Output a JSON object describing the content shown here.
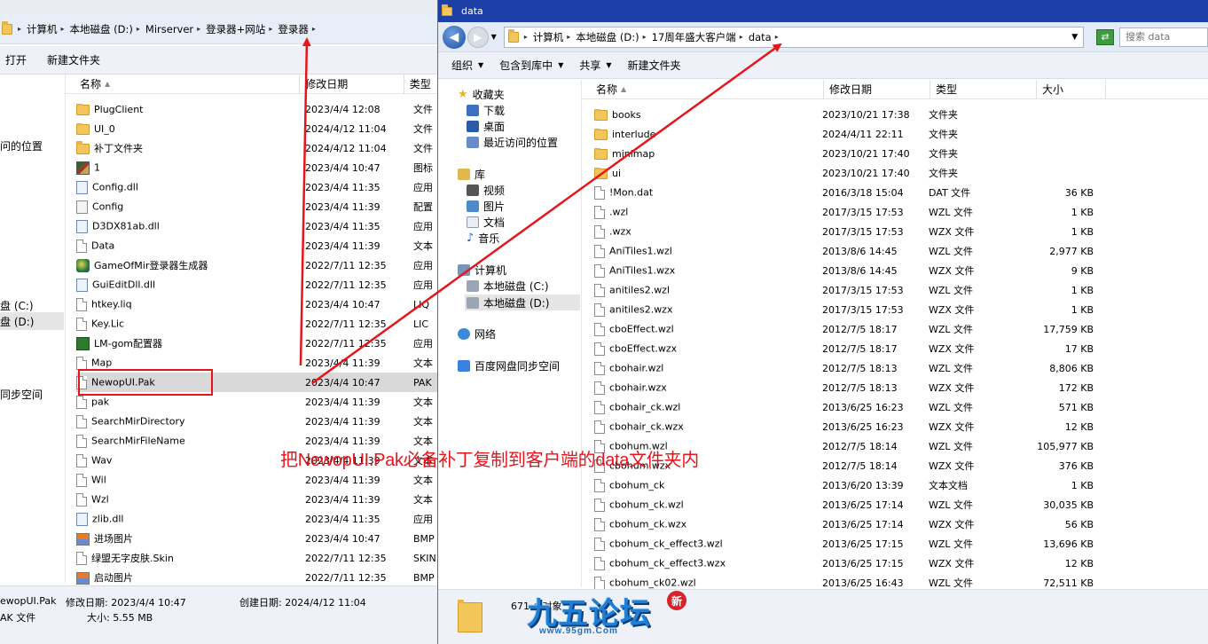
{
  "left_window": {
    "breadcrumbs": [
      "计算机",
      "本地磁盘 (D:)",
      "Mirserver",
      "登录器+网站",
      "登录器"
    ],
    "toolbar": {
      "open": "打开",
      "new_folder": "新建文件夹"
    },
    "nav": {
      "recent": "问的位置",
      "drive_c": "盘 (C:)",
      "drive_d": "盘 (D:)",
      "baidu": "同步空间"
    },
    "columns": {
      "name": "名称",
      "date": "修改日期",
      "type": "类型"
    },
    "files": [
      {
        "name": "PlugClient",
        "date": "2023/4/4 12:08",
        "type": "文件",
        "icon": "folder-icon"
      },
      {
        "name": "UI_0",
        "date": "2024/4/12 11:04",
        "type": "文件",
        "icon": "folder-icon"
      },
      {
        "name": "补丁文件夹",
        "date": "2024/4/12 11:04",
        "type": "文件",
        "icon": "folder-icon"
      },
      {
        "name": "1",
        "date": "2023/4/4 10:47",
        "type": "图标",
        "icon": "image-icon"
      },
      {
        "name": "Config.dll",
        "date": "2023/4/4 11:35",
        "type": "应用",
        "icon": "dll-icon"
      },
      {
        "name": "Config",
        "date": "2023/4/4 11:39",
        "type": "配置",
        "icon": "config-icon"
      },
      {
        "name": "D3DX81ab.dll",
        "date": "2023/4/4 11:35",
        "type": "应用",
        "icon": "dll-icon"
      },
      {
        "name": "Data",
        "date": "2023/4/4 11:39",
        "type": "文本",
        "icon": "file-icon"
      },
      {
        "name": "GameOfMir登录器生成器",
        "date": "2022/7/11 12:35",
        "type": "应用",
        "icon": "app-icon"
      },
      {
        "name": "GuiEditDll.dll",
        "date": "2022/7/11 12:35",
        "type": "应用",
        "icon": "dll-icon"
      },
      {
        "name": "htkey.liq",
        "date": "2023/4/4 10:47",
        "type": "LIQ",
        "icon": "file-icon"
      },
      {
        "name": "Key.Lic",
        "date": "2022/7/11 12:35",
        "type": "LIC",
        "icon": "file-icon"
      },
      {
        "name": "LM-gom配置器",
        "date": "2022/7/11 12:35",
        "type": "应用",
        "icon": "app2-icon"
      },
      {
        "name": "Map",
        "date": "2023/4/4 11:39",
        "type": "文本",
        "icon": "file-icon"
      },
      {
        "name": "NewopUI.Pak",
        "date": "2023/4/4 10:47",
        "type": "PAK",
        "icon": "file-icon",
        "selected": true
      },
      {
        "name": "pak",
        "date": "2023/4/4 11:39",
        "type": "文本",
        "icon": "file-icon"
      },
      {
        "name": "SearchMirDirectory",
        "date": "2023/4/4 11:39",
        "type": "文本",
        "icon": "file-icon"
      },
      {
        "name": "SearchMirFileName",
        "date": "2023/4/4 11:39",
        "type": "文本",
        "icon": "file-icon"
      },
      {
        "name": "Wav",
        "date": "2023/4/4 11:39",
        "type": "文本",
        "icon": "file-icon"
      },
      {
        "name": "Wil",
        "date": "2023/4/4 11:39",
        "type": "文本",
        "icon": "file-icon"
      },
      {
        "name": "Wzl",
        "date": "2023/4/4 11:39",
        "type": "文本",
        "icon": "file-icon"
      },
      {
        "name": "zlib.dll",
        "date": "2023/4/4 11:35",
        "type": "应用",
        "icon": "dll-icon"
      },
      {
        "name": "进场图片",
        "date": "2023/4/4 10:47",
        "type": "BMP",
        "icon": "bmp-icon"
      },
      {
        "name": "绿盟无字皮肤.Skin",
        "date": "2022/7/11 12:35",
        "type": "SKIN",
        "icon": "file-icon"
      },
      {
        "name": "启动图片",
        "date": "2022/7/11 12:35",
        "type": "BMP",
        "icon": "bmp-icon"
      }
    ],
    "status": {
      "name": "ewopUI.Pak",
      "modified": "修改日期: 2023/4/4 10:47",
      "created": "创建日期: 2024/4/12 11:04",
      "kind": "AK 文件",
      "size": "大小: 5.55 MB"
    }
  },
  "right_window": {
    "title": "data",
    "breadcrumbs": [
      "计算机",
      "本地磁盘 (D:)",
      "17周年盛大客户端",
      "data"
    ],
    "search_placeholder": "搜索 data",
    "toolbar": {
      "organize": "组织",
      "include_library": "包含到库中",
      "share": "共享",
      "new_folder": "新建文件夹"
    },
    "nav": {
      "favorites": "收藏夹",
      "downloads": "下载",
      "desktop": "桌面",
      "recent": "最近访问的位置",
      "library": "库",
      "videos": "视频",
      "pictures": "图片",
      "documents": "文档",
      "music": "音乐",
      "computer": "计算机",
      "drive_c": "本地磁盘 (C:)",
      "drive_d": "本地磁盘 (D:)",
      "network": "网络",
      "baidu": "百度网盘同步空间"
    },
    "columns": {
      "name": "名称",
      "date": "修改日期",
      "type": "类型",
      "size": "大小"
    },
    "files": [
      {
        "name": "books",
        "date": "2023/10/21 17:38",
        "type": "文件夹",
        "size": "",
        "icon": "folder-icon"
      },
      {
        "name": "interlude",
        "date": "2024/4/11 22:11",
        "type": "文件夹",
        "size": "",
        "icon": "folder-icon"
      },
      {
        "name": "minimap",
        "date": "2023/10/21 17:40",
        "type": "文件夹",
        "size": "",
        "icon": "folder-icon"
      },
      {
        "name": "ui",
        "date": "2023/10/21 17:40",
        "type": "文件夹",
        "size": "",
        "icon": "folder-icon"
      },
      {
        "name": "!Mon.dat",
        "date": "2016/3/18 15:04",
        "type": "DAT 文件",
        "size": "36 KB",
        "icon": "file-icon"
      },
      {
        "name": ".wzl",
        "date": "2017/3/15 17:53",
        "type": "WZL 文件",
        "size": "1 KB",
        "icon": "file-icon"
      },
      {
        "name": ".wzx",
        "date": "2017/3/15 17:53",
        "type": "WZX 文件",
        "size": "1 KB",
        "icon": "file-icon"
      },
      {
        "name": "AniTiles1.wzl",
        "date": "2013/8/6 14:45",
        "type": "WZL 文件",
        "size": "2,977 KB",
        "icon": "file-icon"
      },
      {
        "name": "AniTiles1.wzx",
        "date": "2013/8/6 14:45",
        "type": "WZX 文件",
        "size": "9 KB",
        "icon": "file-icon"
      },
      {
        "name": "anitiles2.wzl",
        "date": "2017/3/15 17:53",
        "type": "WZL 文件",
        "size": "1 KB",
        "icon": "file-icon"
      },
      {
        "name": "anitiles2.wzx",
        "date": "2017/3/15 17:53",
        "type": "WZX 文件",
        "size": "1 KB",
        "icon": "file-icon"
      },
      {
        "name": "cboEffect.wzl",
        "date": "2012/7/5 18:17",
        "type": "WZL 文件",
        "size": "17,759 KB",
        "icon": "file-icon"
      },
      {
        "name": "cboEffect.wzx",
        "date": "2012/7/5 18:17",
        "type": "WZX 文件",
        "size": "17 KB",
        "icon": "file-icon"
      },
      {
        "name": "cbohair.wzl",
        "date": "2012/7/5 18:13",
        "type": "WZL 文件",
        "size": "8,806 KB",
        "icon": "file-icon"
      },
      {
        "name": "cbohair.wzx",
        "date": "2012/7/5 18:13",
        "type": "WZX 文件",
        "size": "172 KB",
        "icon": "file-icon"
      },
      {
        "name": "cbohair_ck.wzl",
        "date": "2013/6/25 16:23",
        "type": "WZL 文件",
        "size": "571 KB",
        "icon": "file-icon"
      },
      {
        "name": "cbohair_ck.wzx",
        "date": "2013/6/25 16:23",
        "type": "WZX 文件",
        "size": "12 KB",
        "icon": "file-icon"
      },
      {
        "name": "cbohum.wzl",
        "date": "2012/7/5 18:14",
        "type": "WZL 文件",
        "size": "105,977 KB",
        "icon": "file-icon"
      },
      {
        "name": "cbohum.wzx",
        "date": "2012/7/5 18:14",
        "type": "WZX 文件",
        "size": "376 KB",
        "icon": "file-icon"
      },
      {
        "name": "cbohum_ck",
        "date": "2013/6/20 13:39",
        "type": "文本文档",
        "size": "1 KB",
        "icon": "file-icon"
      },
      {
        "name": "cbohum_ck.wzl",
        "date": "2013/6/25 17:14",
        "type": "WZL 文件",
        "size": "30,035 KB",
        "icon": "file-icon"
      },
      {
        "name": "cbohum_ck.wzx",
        "date": "2013/6/25 17:14",
        "type": "WZX 文件",
        "size": "56 KB",
        "icon": "file-icon"
      },
      {
        "name": "cbohum_ck_effect3.wzl",
        "date": "2013/6/25 17:15",
        "type": "WZL 文件",
        "size": "13,696 KB",
        "icon": "file-icon"
      },
      {
        "name": "cbohum_ck_effect3.wzx",
        "date": "2013/6/25 17:15",
        "type": "WZX 文件",
        "size": "12 KB",
        "icon": "file-icon"
      },
      {
        "name": "cbohum_ck02.wzl",
        "date": "2013/6/25 16:43",
        "type": "WZL 文件",
        "size": "72,511 KB",
        "icon": "file-icon"
      }
    ],
    "status": {
      "count": "671 个对象"
    }
  },
  "annotation": {
    "text": "把NewopUI.Pak必备补丁复制到客户端的data文件夹内",
    "color": "#e8141b"
  },
  "watermark": {
    "logo": "九五论坛",
    "url": "www.95gm.Com",
    "badge": "新"
  },
  "colors": {
    "title_bar": "#1c3fa8",
    "address_bar": "#e8eef7",
    "selection": "#d9d9d9",
    "annotation_red": "#e8141b"
  }
}
